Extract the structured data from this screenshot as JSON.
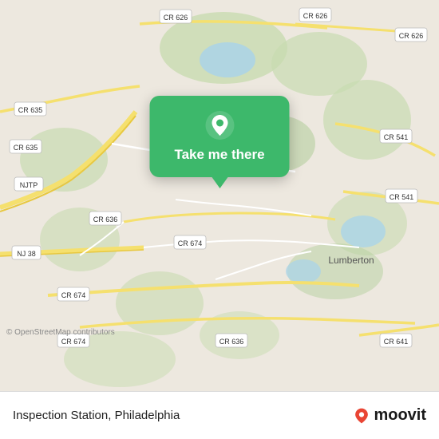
{
  "map": {
    "attribution": "© OpenStreetMap contributors",
    "background_color": "#e8e0d8"
  },
  "tooltip": {
    "label": "Take me there",
    "pin_color": "#ffffff"
  },
  "bottom_bar": {
    "place_name": "Inspection Station, Philadelphia",
    "moovit_label": "moovit"
  },
  "road_labels": [
    "CR 635",
    "CR 626",
    "CR 626",
    "CR 635",
    "NJTP",
    "NJ 38",
    "CR 636",
    "CR 674",
    "CR 674",
    "CR 636",
    "CR 541",
    "CR 541",
    "CR 674",
    "CR 641",
    "Lumberton"
  ]
}
